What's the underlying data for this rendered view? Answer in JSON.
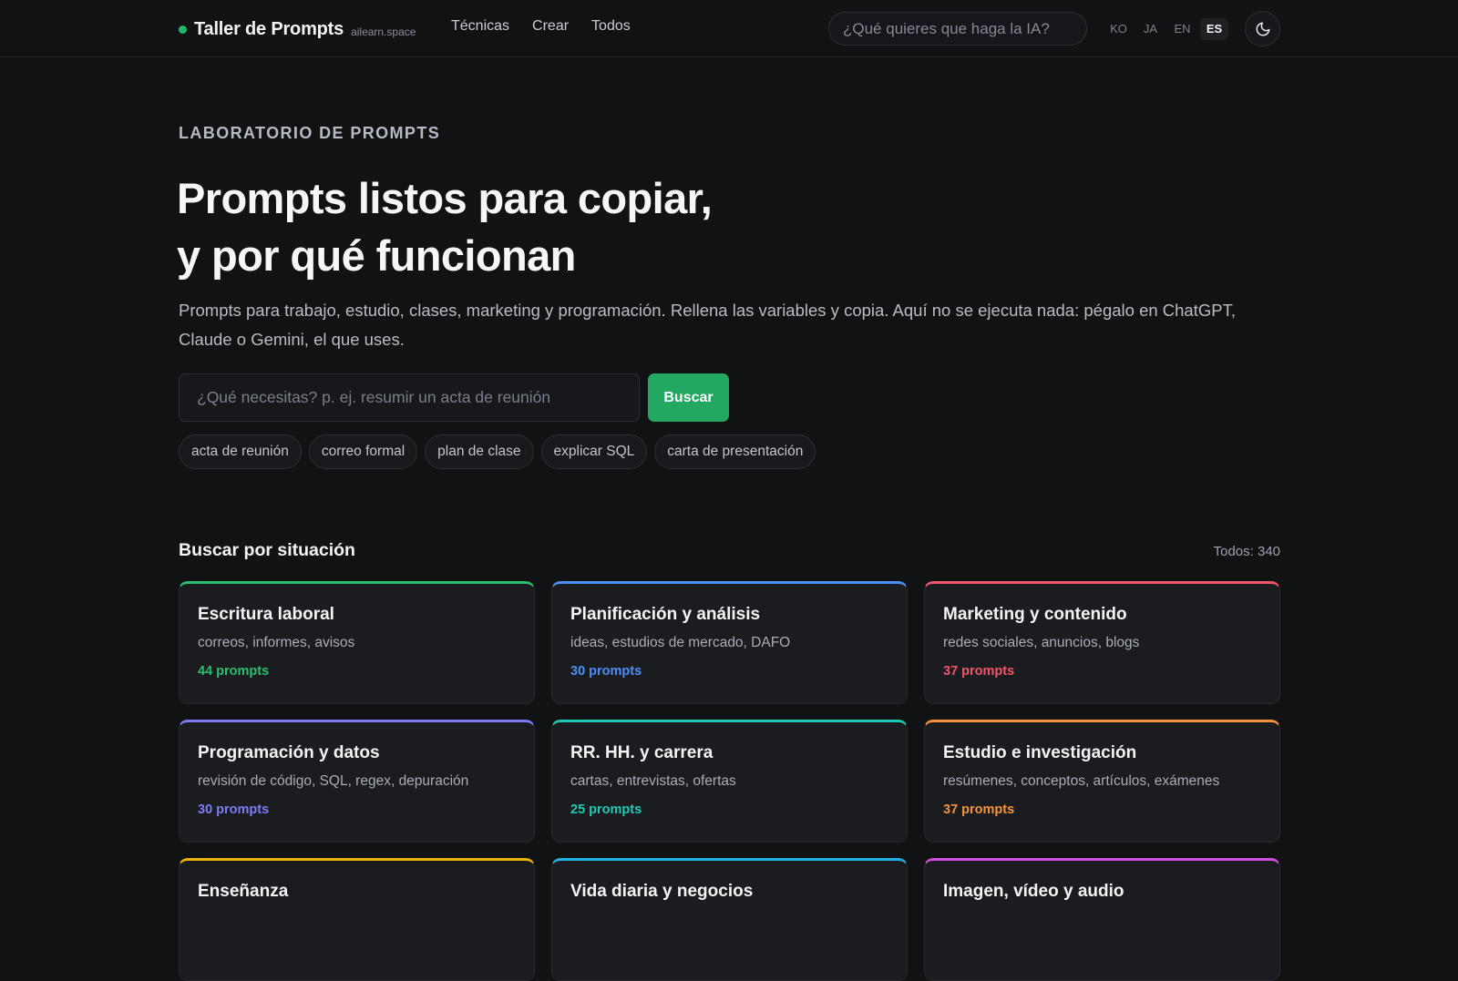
{
  "header": {
    "brand_name": "Taller de Prompts",
    "brand_domain": "ailearn.space",
    "nav": [
      "Técnicas",
      "Crear",
      "Todos"
    ],
    "search_placeholder": "¿Qué quieres que haga la IA?",
    "languages": [
      "KO",
      "JA",
      "EN",
      "ES"
    ],
    "active_language": "ES",
    "theme_toggle_icon": "moon-icon"
  },
  "hero": {
    "eyebrow": "LABORATORIO DE PROMPTS",
    "title_line1": "Prompts listos para copiar,",
    "title_line2": "y por qué funcionan",
    "subtitle": "Prompts para trabajo, estudio, clases, marketing y programación. Rellena las variables y copia. Aquí no se ejecuta nada: pégalo en ChatGPT, Claude o Gemini, el que uses.",
    "search_placeholder": "¿Qué necesitas? p. ej. resumir un acta de reunión",
    "search_button": "Buscar",
    "chips": [
      "acta de reunión",
      "correo formal",
      "plan de clase",
      "explicar SQL",
      "carta de presentación"
    ]
  },
  "situations": {
    "title": "Buscar por situación",
    "total": "Todos: 340",
    "cards": [
      {
        "title": "Escritura laboral",
        "desc": "correos, informes, avisos",
        "count": "44 prompts",
        "color": "#2ebd6f"
      },
      {
        "title": "Planificación y análisis",
        "desc": "ideas, estudios de mercado, DAFO",
        "count": "30 prompts",
        "color": "#4c8ef7"
      },
      {
        "title": "Marketing y contenido",
        "desc": "redes sociales, anuncios, blogs",
        "count": "37 prompts",
        "color": "#f1556a"
      },
      {
        "title": "Programación y datos",
        "desc": "revisión de código, SQL, regex, depuración",
        "count": "30 prompts",
        "color": "#7c7cf5"
      },
      {
        "title": "RR. HH. y carrera",
        "desc": "cartas, entrevistas, ofertas",
        "count": "25 prompts",
        "color": "#1fc9b7"
      },
      {
        "title": "Estudio e investigación",
        "desc": "resúmenes, conceptos, artículos, exámenes",
        "count": "37 prompts",
        "color": "#f59340"
      },
      {
        "title": "Enseñanza",
        "desc": "",
        "count": "",
        "color": "#eab308"
      },
      {
        "title": "Vida diaria y negocios",
        "desc": "",
        "count": "",
        "color": "#22b2e6"
      },
      {
        "title": "Imagen, vídeo y audio",
        "desc": "",
        "count": "",
        "color": "#d04ee0"
      }
    ]
  },
  "colors": {
    "background": "#111214",
    "accent": "#22a861",
    "card_background": "#1a1c20"
  }
}
